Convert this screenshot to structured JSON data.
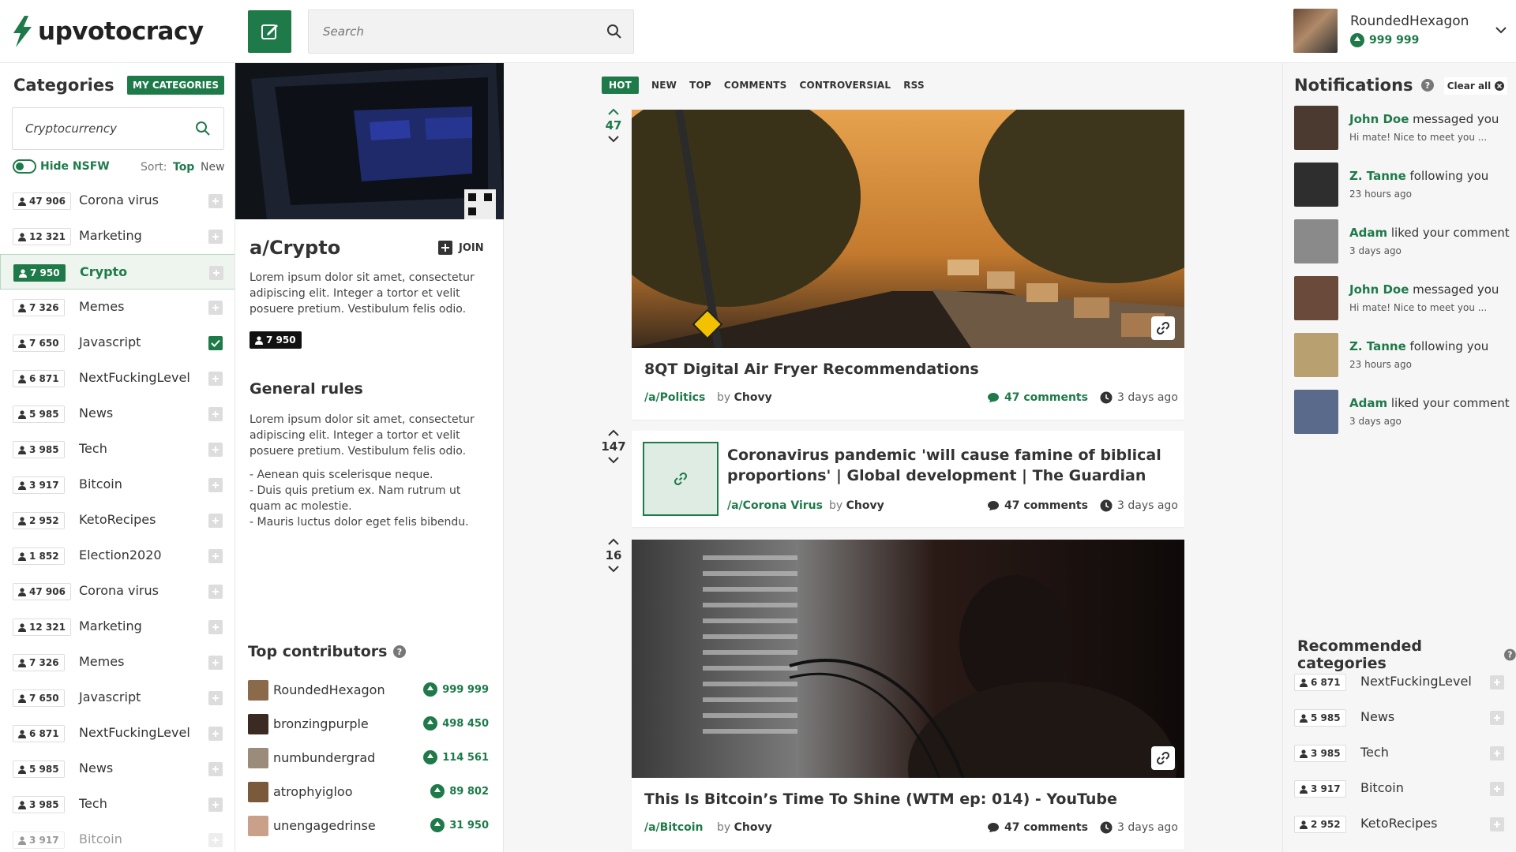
{
  "header": {
    "logo_text": "upvotocracy",
    "search_placeholder": "Search",
    "user": {
      "name": "RoundedHexagon",
      "points": "999 999"
    }
  },
  "sidebar": {
    "title": "Categories",
    "my_categories_label": "MY CATEGORIES",
    "search_value": "Cryptocurrency",
    "nsfw_label": "Hide NSFW",
    "sort_label": "Sort:",
    "sort_top": "Top",
    "sort_new": "New",
    "categories": [
      {
        "count": "47 906",
        "name": "Corona virus"
      },
      {
        "count": "12 321",
        "name": "Marketing"
      },
      {
        "count": "7 950",
        "name": "Crypto"
      },
      {
        "count": "7 326",
        "name": "Memes"
      },
      {
        "count": "7 650",
        "name": "Javascript"
      },
      {
        "count": "6 871",
        "name": "NextFuckingLevel"
      },
      {
        "count": "5 985",
        "name": "News"
      },
      {
        "count": "3 985",
        "name": "Tech"
      },
      {
        "count": "3 917",
        "name": "Bitcoin"
      },
      {
        "count": "2 952",
        "name": "KetoRecipes"
      },
      {
        "count": "1 852",
        "name": "Election2020"
      },
      {
        "count": "47 906",
        "name": "Corona virus"
      },
      {
        "count": "12 321",
        "name": "Marketing"
      },
      {
        "count": "7 326",
        "name": "Memes"
      },
      {
        "count": "7 650",
        "name": "Javascript"
      },
      {
        "count": "6 871",
        "name": "NextFuckingLevel"
      },
      {
        "count": "5 985",
        "name": "News"
      },
      {
        "count": "3 985",
        "name": "Tech"
      },
      {
        "count": "3 917",
        "name": "Bitcoin"
      }
    ]
  },
  "community": {
    "name": "a/Crypto",
    "join_label": "JOIN",
    "description": "Lorem ipsum dolor sit amet, consectetur adipiscing elit. Integer a tortor et velit posuere pretium. Vestibulum felis odio.",
    "members": "7 950",
    "rules_title": "General rules",
    "rules_intro": "Lorem ipsum dolor sit amet, consectetur adipiscing elit. Integer a tortor et velit posuere pretium. Vestibulum felis odio.",
    "rules_list": [
      "- Aenean quis scelerisque neque.",
      "- Duis quis pretium ex. Nam rutrum ut quam ac molestie.",
      "- Mauris luctus dolor eget felis bibendu."
    ],
    "contributors_title": "Top contributors",
    "contributors": [
      {
        "name": "RoundedHexagon",
        "points": "999 999"
      },
      {
        "name": "bronzingpurple",
        "points": "498 450"
      },
      {
        "name": "numbundergrad",
        "points": "114 561"
      },
      {
        "name": "atrophyigloo",
        "points": "89 802"
      },
      {
        "name": "unengagedrinse",
        "points": "31 950"
      }
    ]
  },
  "feed": {
    "tabs": [
      "HOT",
      "NEW",
      "TOP",
      "COMMENTS",
      "CONTROVERSIAL",
      "RSS"
    ],
    "posts": [
      {
        "votes": "47",
        "title": "8QT Digital Air Fryer Recommendations",
        "category": "/a/Politics",
        "by_label": "by",
        "author": "Chovy",
        "comments": "47 comments",
        "time": "3 days ago"
      },
      {
        "votes": "147",
        "title_line1": "Coronavirus pandemic 'will cause famine of biblical",
        "title_line2": "proportions' | Global development | The Guardian",
        "category": "/a/Corona Virus",
        "by_label": "by",
        "author": "Chovy",
        "comments": "47 comments",
        "time": "3 days ago"
      },
      {
        "votes": "16",
        "title": "This Is Bitcoin’s Time To Shine (WTM ep: 014) - YouTube",
        "category": "/a/Bitcoin",
        "by_label": "by",
        "author": "Chovy",
        "comments": "47 comments",
        "time": "3 days ago"
      }
    ]
  },
  "notifications": {
    "title": "Notifications",
    "clear_label": "Clear all",
    "items": [
      {
        "who": "John Doe",
        "action": " messaged you",
        "sub": "Hi mate! Nice to meet you ..."
      },
      {
        "who": "Z. Tanne",
        "action": " following you",
        "sub": "23 hours ago"
      },
      {
        "who": "Adam",
        "action": " liked your comment",
        "sub": "3 days ago"
      },
      {
        "who": "John Doe",
        "action": " messaged you",
        "sub": "Hi mate! Nice to meet you ..."
      },
      {
        "who": "Z. Tanne",
        "action": " following you",
        "sub": "23 hours ago"
      },
      {
        "who": "Adam",
        "action": " liked your comment",
        "sub": "3 days ago"
      }
    ]
  },
  "recommended": {
    "title": "Recommended categories",
    "items": [
      {
        "count": "6 871",
        "name": "NextFuckingLevel"
      },
      {
        "count": "5 985",
        "name": "News"
      },
      {
        "count": "3 985",
        "name": "Tech"
      },
      {
        "count": "3 917",
        "name": "Bitcoin"
      },
      {
        "count": "2 952",
        "name": "KetoRecipes"
      }
    ]
  },
  "colors": {
    "accent": "#1f7a4a",
    "background": "#f6f6f6"
  }
}
